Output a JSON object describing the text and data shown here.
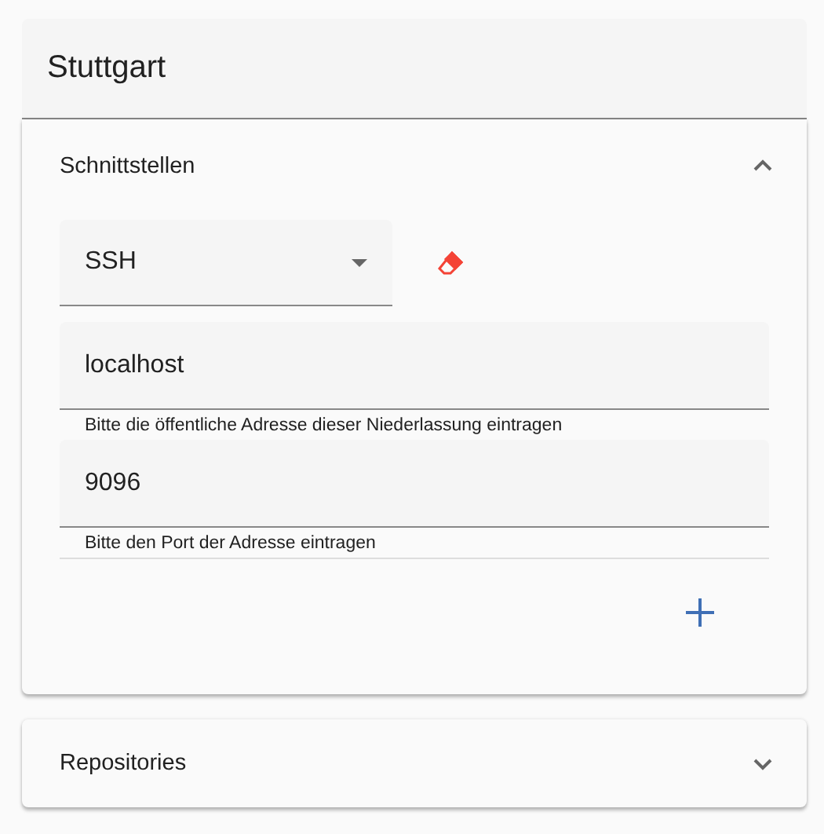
{
  "header": {
    "title": "Stuttgart"
  },
  "panels": [
    {
      "title": "Schnittstellen",
      "expanded": true,
      "select": {
        "value": "SSH"
      },
      "fields": [
        {
          "value": "localhost",
          "hint": "Bitte die öffentliche Adresse dieser Niederlassung eintragen"
        },
        {
          "value": "9096",
          "hint": "Bitte den Port der Adresse eintragen"
        }
      ]
    },
    {
      "title": "Repositories",
      "expanded": false
    }
  ]
}
